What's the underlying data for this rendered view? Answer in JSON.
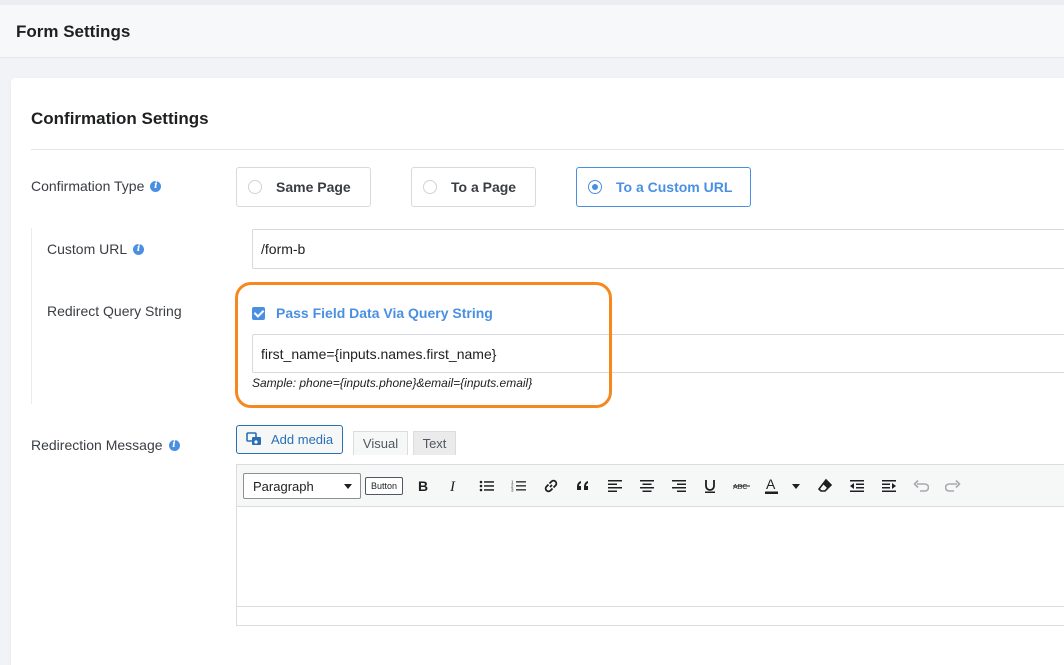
{
  "header": {
    "title": "Form Settings"
  },
  "section": {
    "title": "Confirmation Settings"
  },
  "confirmation_type": {
    "label": "Confirmation Type",
    "options": [
      {
        "label": "Same Page",
        "selected": false
      },
      {
        "label": "To a Page",
        "selected": false
      },
      {
        "label": "To a Custom URL",
        "selected": true
      }
    ]
  },
  "custom_url": {
    "label": "Custom URL",
    "value": "/form-b"
  },
  "redirect_query": {
    "label": "Redirect Query String",
    "checkbox_label": "Pass Field Data Via Query String",
    "checked": true,
    "value": "first_name={inputs.names.first_name}",
    "sample": "Sample: phone={inputs.phone}&email={inputs.email}"
  },
  "redirection_message": {
    "label": "Redirection Message",
    "add_media_label": "Add media",
    "tabs": [
      "Visual",
      "Text"
    ],
    "format_select": "Paragraph",
    "button_label": "Button",
    "toolbar_icons": [
      "bold-icon",
      "italic-icon",
      "bullet-list-icon",
      "numbered-list-icon",
      "link-icon",
      "blockquote-icon",
      "align-left-icon",
      "align-center-icon",
      "align-right-icon",
      "underline-icon",
      "strikethrough-icon",
      "text-color-icon",
      "clear-formatting-icon",
      "outdent-icon",
      "indent-icon",
      "undo-icon",
      "redo-icon"
    ]
  },
  "colors": {
    "accent": "#4a90e2",
    "highlight": "#f5881f",
    "media_blue": "#2a6fb5"
  }
}
